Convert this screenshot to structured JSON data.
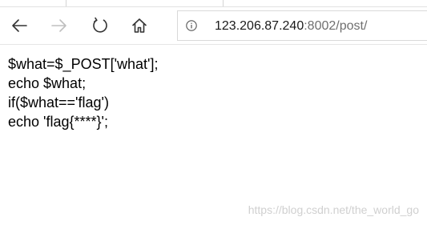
{
  "browser": {
    "toolbar": {
      "back_icon": "arrow-left-icon",
      "forward_icon": "arrow-right-icon",
      "forward_enabled": false,
      "refresh_icon": "refresh-icon",
      "home_icon": "home-icon"
    },
    "address_bar": {
      "info_icon": "info-circle-icon",
      "url_host": "123.206.87.240",
      "url_rest": ":8002/post/"
    }
  },
  "page": {
    "lines": [
      "$what=$_POST['what'];",
      "echo $what;",
      "if($what=='flag')",
      "echo 'flag{****}';"
    ]
  },
  "watermark": {
    "text": "https://blog.csdn.net/the_world_go"
  },
  "colors": {
    "icon": "#333333",
    "icon_disabled": "#bfbfbf",
    "url_host": "#1a1a1a",
    "url_rest": "#6f6f6f",
    "watermark": "#d0d0d0"
  }
}
